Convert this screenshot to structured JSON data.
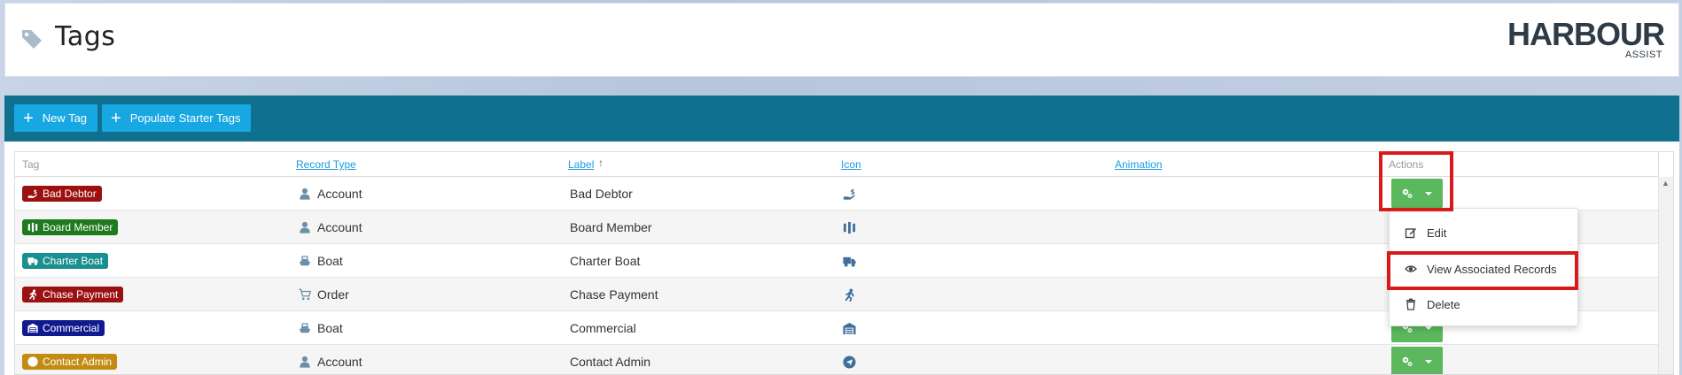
{
  "page": {
    "title": "Tags"
  },
  "logo": {
    "main": "HARBOUR",
    "sub": "ASSIST"
  },
  "toolbar": {
    "new_tag": "New Tag",
    "populate": "Populate Starter Tags"
  },
  "table": {
    "columns": {
      "tag": "Tag",
      "record_type": "Record Type",
      "label": "Label",
      "label_sort": "↑",
      "icon": "Icon",
      "animation": "Animation",
      "actions": "Actions"
    },
    "rows": [
      {
        "tag": "Bad Debtor",
        "tag_color": "#9b1010",
        "tag_icon": "hand-holding-dollar-icon",
        "record_type": "Account",
        "record_type_icon": "user-icon",
        "label": "Bad Debtor",
        "icon": "hand-holding-dollar-icon"
      },
      {
        "tag": "Board Member",
        "tag_color": "#1e7a1e",
        "tag_icon": "users-icon",
        "record_type": "Account",
        "record_type_icon": "user-icon",
        "label": "Board Member",
        "icon": "users-icon"
      },
      {
        "tag": "Charter Boat",
        "tag_color": "#1a8f8f",
        "tag_icon": "truck-icon",
        "record_type": "Boat",
        "record_type_icon": "ship-icon",
        "label": "Charter Boat",
        "icon": "truck-icon"
      },
      {
        "tag": "Chase Payment",
        "tag_color": "#9b1010",
        "tag_icon": "running-icon",
        "record_type": "Order",
        "record_type_icon": "cart-icon",
        "label": "Chase Payment",
        "icon": "running-icon"
      },
      {
        "tag": "Commercial",
        "tag_color": "#101a8f",
        "tag_icon": "warehouse-icon",
        "record_type": "Boat",
        "record_type_icon": "ship-icon",
        "label": "Commercial",
        "icon": "warehouse-icon"
      },
      {
        "tag": "Contact Admin",
        "tag_color": "#c48b12",
        "tag_icon": "paper-plane-icon",
        "record_type": "Account",
        "record_type_icon": "user-icon",
        "label": "Contact Admin",
        "icon": "paper-plane-icon"
      }
    ]
  },
  "dropdown": {
    "items": [
      {
        "label": "Edit",
        "icon": "edit-icon"
      },
      {
        "label": "View Associated Records",
        "icon": "eye-icon"
      },
      {
        "label": "Delete",
        "icon": "trash-icon"
      }
    ]
  },
  "colors": {
    "band": "#10708f",
    "button_blue": "#17a8e3",
    "action_green": "#5cb85c",
    "link": "#1a9be0",
    "highlight": "#d71a1a"
  }
}
